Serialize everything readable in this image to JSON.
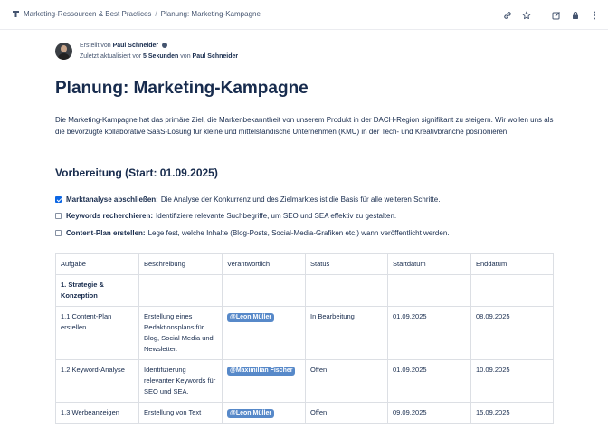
{
  "breadcrumb": {
    "space": "Marketing-Ressourcen & Best Practices",
    "separator": "/",
    "page": "Planung: Marketing-Kampagne"
  },
  "toolbar": {
    "icons": [
      "link-icon",
      "star-icon",
      "edit-icon",
      "lock-icon",
      "more-icon"
    ]
  },
  "byline": {
    "created_prefix": "Erstellt von",
    "author": "Paul Schneider",
    "updated_prefix": "Zuletzt aktualisiert vor",
    "updated_time": "5 Sekunden",
    "updated_by_prefix": "von",
    "updated_by": "Paul Schneider"
  },
  "page": {
    "title": "Planung: Marketing-Kampagne",
    "intro": "Die Marketing-Kampagne hat das primäre Ziel, die Markenbekanntheit von unserem Produkt in der DACH-Region signifikant zu steigern. Wir wollen uns als die bevorzugte kollaborative SaaS-Lösung für kleine und mittelständische Unternehmen (KMU) in der Tech- und Kreativbranche positionieren.",
    "section_heading": "Vorbereitung (Start: 01.09.2025)"
  },
  "tasks": [
    {
      "checked": true,
      "title": "Marktanalyse abschließen:",
      "text": "Die Analyse der Konkurrenz und des Zielmarktes ist die Basis für alle weiteren Schritte."
    },
    {
      "checked": false,
      "title": "Keywords recherchieren:",
      "text": "Identifiziere relevante Suchbegriffe, um SEO und SEA effektiv zu gestalten."
    },
    {
      "checked": false,
      "title": "Content-Plan erstellen:",
      "text": "Lege fest, welche Inhalte (Blog-Posts, Social-Media-Grafiken etc.) wann veröffentlicht werden."
    }
  ],
  "table": {
    "headers": [
      "Aufgabe",
      "Beschreibung",
      "Verantwortlich",
      "Status",
      "Startdatum",
      "Enddatum"
    ],
    "group_row": "1. Strategie & Konzeption",
    "rows": [
      {
        "task": "1.1 Content-Plan erstellen",
        "description": "Erstellung eines Redaktionsplans für Blog, Social Media und Newsletter.",
        "owner": "@Leon Müller",
        "status": "In Bearbeitung",
        "start": "01.09.2025",
        "end": "08.09.2025"
      },
      {
        "task": "1.2 Keyword-Analyse",
        "description": "Identifizierung relevanter Keywords für SEO und SEA.",
        "owner": "@Maximilian Fischer",
        "status": "Offen",
        "start": "01.09.2025",
        "end": "10.09.2025"
      },
      {
        "task": "1.3 Werbeanzeigen",
        "description": "Erstellung von Text",
        "owner": "@Leon Müller",
        "status": "Offen",
        "start": "09.09.2025",
        "end": "15.09.2025"
      }
    ]
  },
  "colors": {
    "accent": "#0c66e4",
    "mention": "#5789c9",
    "text": "#172b4d",
    "subtle": "#44546f"
  }
}
